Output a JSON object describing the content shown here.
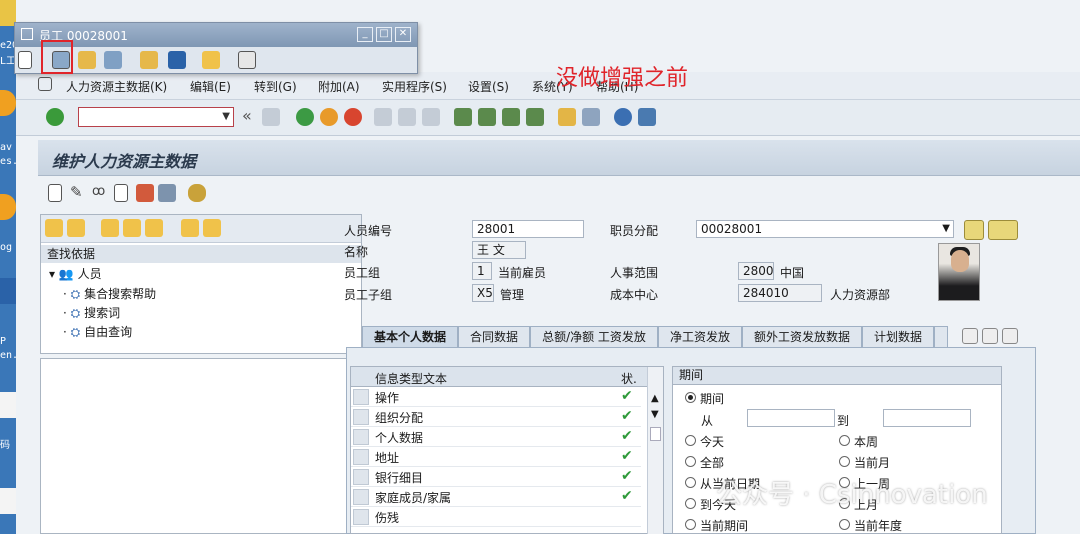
{
  "colors": {
    "accent_red": "#e0242a",
    "title_blue": "#7f97b4",
    "ok_green": "#2e9a3a"
  },
  "desktop": {
    "snippets": [
      "e20",
      "L工",
      "av",
      "es.",
      "og",
      "P",
      "en.",
      "码"
    ]
  },
  "popup": {
    "title": "员工 00028001",
    "buttons": [
      "min",
      "max",
      "close"
    ]
  },
  "annotation": "没做增强之前",
  "menu": [
    "人力资源主数据(K)",
    "编辑(E)",
    "转到(G)",
    "附加(A)",
    "实用程序(S)",
    "设置(S)",
    "系统(Y)",
    "帮助(H)"
  ],
  "command_field": {
    "value": ""
  },
  "page_title": "维护人力资源主数据",
  "object_manager": {
    "header": "查找依据",
    "root": "人员",
    "items": [
      "集合搜索帮助",
      "搜索词",
      "自由查询"
    ]
  },
  "header": {
    "pernr_label": "人员编号",
    "pernr": "28001",
    "name_label": "名称",
    "name": "王 文",
    "ee_group_label": "员工组",
    "ee_group": "1",
    "ee_group_text": "当前雇员",
    "ee_subgroup_label": "员工子组",
    "ee_subgroup": "X5",
    "ee_subgroup_text": "管理",
    "assignment_label": "职员分配",
    "assignment": "00028001",
    "pa_label": "人事范围",
    "pa": "2800",
    "pa_text": "中国",
    "cc_label": "成本中心",
    "cc": "284010",
    "cc_text": "人力资源部"
  },
  "tabs": [
    "基本个人数据",
    "合同数据",
    "总额/净额 工资发放",
    "净工资发放",
    "额外工资发放数据",
    "计划数据"
  ],
  "infotypes": {
    "col_text": "信息类型文本",
    "col_status": "状.",
    "rows": [
      {
        "text": "操作",
        "status": "✔"
      },
      {
        "text": "组织分配",
        "status": "✔"
      },
      {
        "text": "个人数据",
        "status": "✔"
      },
      {
        "text": "地址",
        "status": "✔"
      },
      {
        "text": "银行细目",
        "status": "✔"
      },
      {
        "text": "家庭成员/家属",
        "status": "✔"
      },
      {
        "text": "伤残",
        "status": ""
      }
    ]
  },
  "period": {
    "title": "期间",
    "period_option": "期间",
    "from_label": "从",
    "to_label": "到",
    "left_options": [
      "今天",
      "全部",
      "从当前日期",
      "到今天",
      "当前期间"
    ],
    "right_options": [
      "本周",
      "当前月",
      "上一周",
      "上月",
      "当前年度"
    ]
  },
  "watermark": "公众号 · Csinnovation"
}
